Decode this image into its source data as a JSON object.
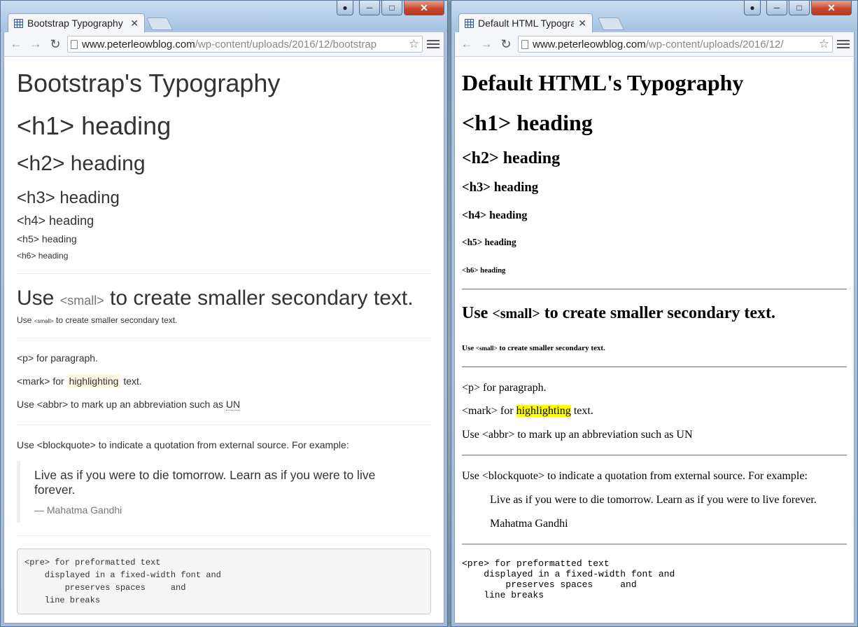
{
  "left": {
    "tab_title": "Bootstrap Typography",
    "url_host": "www.peterleowblog.com",
    "url_path": "/wp-content/uploads/2016/12/bootstrap",
    "page": {
      "title": "Bootstrap's Typography",
      "h1": "<h1> heading",
      "h2": "<h2> heading",
      "h3": "<h3> heading",
      "h4": "<h4> heading",
      "h5": "<h5> heading",
      "h6": "<h6> heading",
      "use_prefix": "Use ",
      "small_tag": "<small>",
      "use_suffix": " to create smaller secondary text.",
      "p_text": "<p> for paragraph.",
      "mark_prefix": "<mark> for ",
      "mark_word": "highlighting",
      "mark_suffix": " text.",
      "abbr_prefix": "Use <abbr> to mark up an abbreviation such as ",
      "abbr_word": "UN",
      "blockquote_intro": "Use <blockquote> to indicate a quotation from external source. For example:",
      "quote": "Live as if you were to die tomorrow. Learn as if you were to live forever.",
      "cite": "— Mahatma Gandhi",
      "pre": "<pre> for preformatted text\n    displayed in a fixed-width font and\n        preserves spaces     and\n    line breaks"
    }
  },
  "right": {
    "tab_title": "Default HTML Typography",
    "url_host": "www.peterleowblog.com",
    "url_path": "/wp-content/uploads/2016/12/",
    "page": {
      "title": "Default HTML's Typography",
      "h1": "<h1> heading",
      "h2": "<h2> heading",
      "h3": "<h3> heading",
      "h4": "<h4> heading",
      "h5": "<h5> heading",
      "h6": "<h6> heading",
      "use_prefix": "Use ",
      "small_tag": "<small>",
      "use_suffix": " to create smaller secondary text.",
      "p_text": "<p> for paragraph.",
      "mark_prefix": "<mark> for ",
      "mark_word": "highlighting",
      "mark_suffix": " text.",
      "abbr_prefix": "Use <abbr> to mark up an abbreviation such as ",
      "abbr_word": "UN",
      "blockquote_intro": "Use <blockquote> to indicate a quotation from external source. For example:",
      "quote": "Live as if you were to die tomorrow. Learn as if you were to live forever.",
      "cite": "Mahatma Gandhi",
      "pre": "<pre> for preformatted text\n    displayed in a fixed-width font and\n        preserves spaces     and\n    line breaks"
    }
  },
  "icons": {
    "back": "arrow-left-icon",
    "forward": "arrow-right-icon",
    "reload": "reload-icon",
    "page": "page-icon",
    "star": "star-icon",
    "menu": "hamburger-menu-icon",
    "close_tab": "close-icon"
  },
  "colors": {
    "mark_bootstrap": "#fcf8e3",
    "mark_default": "#ffff00",
    "close_button": "#c8452c"
  }
}
